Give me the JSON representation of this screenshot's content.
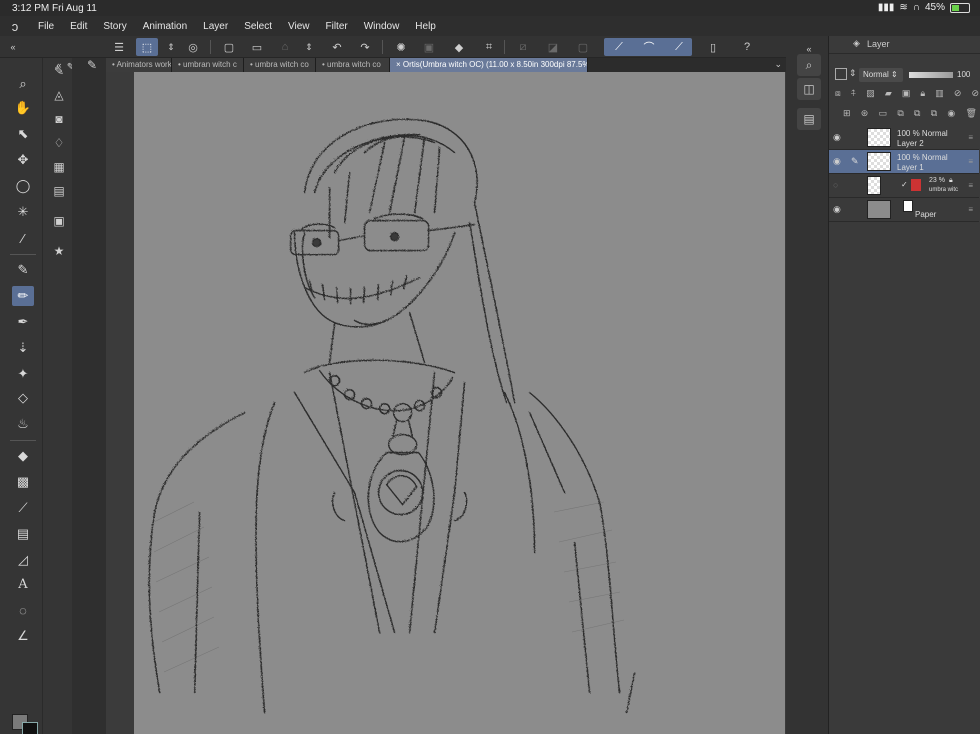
{
  "status": {
    "time": "3:12 PM",
    "date": "Fri Aug 11",
    "battery": "45%",
    "battery_level": 0.45
  },
  "menu": [
    "File",
    "Edit",
    "Story",
    "Animation",
    "Layer",
    "Select",
    "View",
    "Filter",
    "Window",
    "Help"
  ],
  "tabs": [
    {
      "label": "Animators work",
      "active": false
    },
    {
      "label": "umbran witch c",
      "active": false
    },
    {
      "label": "umbra witch co",
      "active": false
    },
    {
      "label": "umbra witch co",
      "active": false
    },
    {
      "label": "Ortis(Umbra witch OC) (11.00 x 8.50in 300dpi 87.5%)",
      "active": true
    }
  ],
  "layer_panel": {
    "title": "Layer",
    "blend_mode": "Normal",
    "opacity": "100",
    "layers": [
      {
        "opacity": "100 %",
        "mode": "Normal",
        "name": "Layer 2",
        "selected": false
      },
      {
        "opacity": "100 %",
        "mode": "Normal",
        "name": "Layer 1",
        "selected": true
      },
      {
        "opacity": "23 %",
        "mode": "",
        "name": "umbra witc",
        "selected": false
      },
      {
        "opacity": "",
        "mode": "",
        "name": "Paper",
        "selected": false
      }
    ]
  },
  "colors": {
    "accent": "#5a6f95",
    "canvas": "#8c8c8c",
    "main_color": "#7a7a7a",
    "sub_color": "#111111"
  }
}
